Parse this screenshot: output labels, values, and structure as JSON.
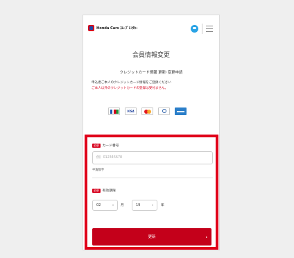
{
  "header": {
    "logo_text": "Honda Cars ｽﾑｰﾌﾞﾚﾝﾀｶｰ"
  },
  "page": {
    "title": "会員情報変更",
    "subtitle": "クレジットカード情報 更新･変更申請",
    "note_line1": "申込者ご本人のクレジットカード情報をご登録ください",
    "note_line2": "ご本人以外のクレジットカードの登録は受付ません。"
  },
  "card_brands": [
    "jcb-icon",
    "visa-icon",
    "mastercard-icon",
    "diners-icon",
    "amex-icon"
  ],
  "card_brand_visa_text": "VISA",
  "form": {
    "required_badge": "必須",
    "card_number_label": "カード番号",
    "card_number_placeholder": "例）012345678",
    "card_number_value": "",
    "card_number_hint": "半角数字",
    "expiry_label": "有効期限",
    "month_value": "02",
    "month_unit": "月",
    "year_value": "19",
    "year_unit": "年",
    "select_arrow": "▾",
    "submit_label": "更新",
    "submit_chevron": "▸"
  },
  "colors": {
    "accent_red": "#d6001c",
    "highlight_border": "#e0001a",
    "chat_blue": "#29a3e5"
  }
}
